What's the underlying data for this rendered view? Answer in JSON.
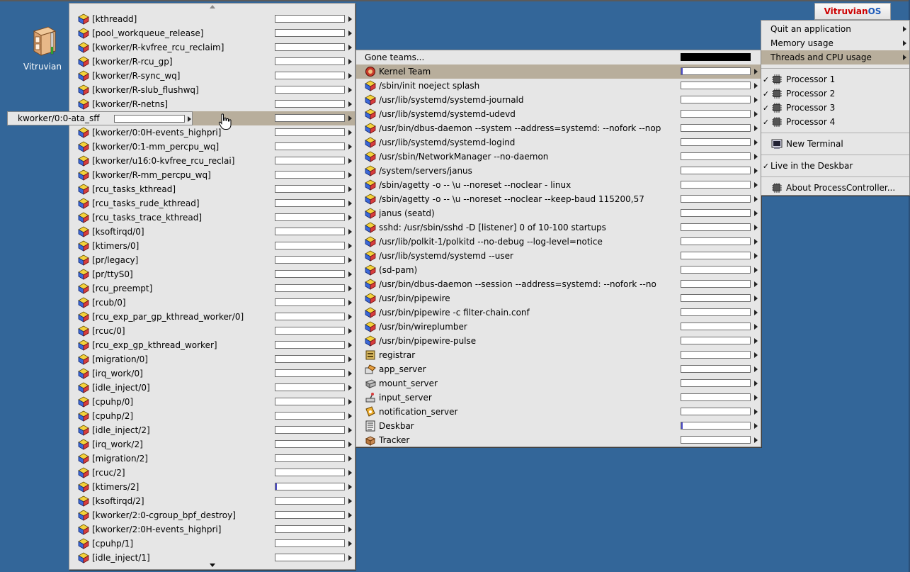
{
  "desktop": {
    "icon_label": "Vitruvian"
  },
  "deskbar": {
    "brand_part1": "Vitruvian",
    "brand_part2": "OS"
  },
  "tooltip": {
    "text": "kworker/0:0-ata_sff"
  },
  "threads": [
    {
      "name": "[kthreadd]",
      "load": 0
    },
    {
      "name": "[pool_workqueue_release]",
      "load": 0
    },
    {
      "name": "[kworker/R-kvfree_rcu_reclaim]",
      "load": 0
    },
    {
      "name": "[kworker/R-rcu_gp]",
      "load": 0
    },
    {
      "name": "[kworker/R-sync_wq]",
      "load": 0
    },
    {
      "name": "[kworker/R-slub_flushwq]",
      "load": 0
    },
    {
      "name": "[kworker/R-netns]",
      "load": 0
    },
    {
      "name": "",
      "load": 0,
      "selected": true
    },
    {
      "name": "[kworker/0:0H-events_highpri]",
      "load": 0
    },
    {
      "name": "[kworker/0:1-mm_percpu_wq]",
      "load": 0
    },
    {
      "name": "[kworker/u16:0-kvfree_rcu_reclai]",
      "load": 0
    },
    {
      "name": "[kworker/R-mm_percpu_wq]",
      "load": 0
    },
    {
      "name": "[rcu_tasks_kthread]",
      "load": 0
    },
    {
      "name": "[rcu_tasks_rude_kthread]",
      "load": 0
    },
    {
      "name": "[rcu_tasks_trace_kthread]",
      "load": 0
    },
    {
      "name": "[ksoftirqd/0]",
      "load": 0
    },
    {
      "name": "[ktimers/0]",
      "load": 0
    },
    {
      "name": "[pr/legacy]",
      "load": 0
    },
    {
      "name": "[pr/ttyS0]",
      "load": 0
    },
    {
      "name": "[rcu_preempt]",
      "load": 0
    },
    {
      "name": "[rcub/0]",
      "load": 0
    },
    {
      "name": "[rcu_exp_par_gp_kthread_worker/0]",
      "load": 0
    },
    {
      "name": "[rcuc/0]",
      "load": 0
    },
    {
      "name": "[rcu_exp_gp_kthread_worker]",
      "load": 0
    },
    {
      "name": "[migration/0]",
      "load": 0
    },
    {
      "name": "[irq_work/0]",
      "load": 0
    },
    {
      "name": "[idle_inject/0]",
      "load": 0
    },
    {
      "name": "[cpuhp/0]",
      "load": 0
    },
    {
      "name": "[cpuhp/2]",
      "load": 0
    },
    {
      "name": "[idle_inject/2]",
      "load": 0
    },
    {
      "name": "[irq_work/2]",
      "load": 0
    },
    {
      "name": "[migration/2]",
      "load": 0
    },
    {
      "name": "[rcuc/2]",
      "load": 0
    },
    {
      "name": "[ktimers/2]",
      "load": 0.01
    },
    {
      "name": "[ksoftirqd/2]",
      "load": 0
    },
    {
      "name": "[kworker/2:0-cgroup_bpf_destroy]",
      "load": 0
    },
    {
      "name": "[kworker/2:0H-events_highpri]",
      "load": 0
    },
    {
      "name": "[cpuhp/1]",
      "load": 0
    },
    {
      "name": "[idle_inject/1]",
      "load": 0
    }
  ],
  "teams": {
    "gone_label": "Gone teams...",
    "items": [
      {
        "name": "Kernel Team",
        "icon": "kernel-icon",
        "load": 0.01,
        "selected": true
      },
      {
        "name": "/sbin/init noeject splash",
        "icon": "app-icon",
        "load": 0
      },
      {
        "name": "/usr/lib/systemd/systemd-journald",
        "icon": "app-icon",
        "load": 0
      },
      {
        "name": "/usr/lib/systemd/systemd-udevd",
        "icon": "app-icon",
        "load": 0
      },
      {
        "name": "/usr/bin/dbus-daemon --system --address=systemd: --nofork --nop",
        "icon": "app-icon",
        "load": 0
      },
      {
        "name": "/usr/lib/systemd/systemd-logind",
        "icon": "app-icon",
        "load": 0
      },
      {
        "name": "/usr/sbin/NetworkManager --no-daemon",
        "icon": "app-icon",
        "load": 0
      },
      {
        "name": "/system/servers/janus",
        "icon": "app-icon",
        "load": 0
      },
      {
        "name": "/sbin/agetty -o -- \\u --noreset --noclear - linux",
        "icon": "app-icon",
        "load": 0
      },
      {
        "name": "/sbin/agetty -o -- \\u --noreset --noclear --keep-baud 115200,57",
        "icon": "app-icon",
        "load": 0
      },
      {
        "name": "janus (seatd)",
        "icon": "app-icon",
        "load": 0
      },
      {
        "name": "sshd: /usr/sbin/sshd -D [listener] 0 of 10-100 startups",
        "icon": "app-icon",
        "load": 0
      },
      {
        "name": "/usr/lib/polkit-1/polkitd --no-debug --log-level=notice",
        "icon": "app-icon",
        "load": 0
      },
      {
        "name": "/usr/lib/systemd/systemd --user",
        "icon": "app-icon",
        "load": 0
      },
      {
        "name": "(sd-pam)",
        "icon": "app-icon",
        "load": 0
      },
      {
        "name": "/usr/bin/dbus-daemon --session --address=systemd: --nofork --no",
        "icon": "app-icon",
        "load": 0
      },
      {
        "name": "/usr/bin/pipewire",
        "icon": "app-icon",
        "load": 0
      },
      {
        "name": "/usr/bin/pipewire -c filter-chain.conf",
        "icon": "app-icon",
        "load": 0
      },
      {
        "name": "/usr/bin/wireplumber",
        "icon": "app-icon",
        "load": 0
      },
      {
        "name": "/usr/bin/pipewire-pulse",
        "icon": "app-icon",
        "load": 0
      },
      {
        "name": "registrar",
        "icon": "registrar-icon",
        "load": 0
      },
      {
        "name": "app_server",
        "icon": "app-server-icon",
        "load": 0
      },
      {
        "name": "mount_server",
        "icon": "mount-server-icon",
        "load": 0
      },
      {
        "name": "input_server",
        "icon": "input-server-icon",
        "load": 0
      },
      {
        "name": "notification_server",
        "icon": "notification-icon",
        "load": 0
      },
      {
        "name": "Deskbar",
        "icon": "deskbar-icon",
        "load": 0.01
      },
      {
        "name": "Tracker",
        "icon": "tracker-icon",
        "load": 0
      }
    ]
  },
  "process_controller": {
    "quit_app": "Quit an application",
    "memory_usage": "Memory usage",
    "threads_cpu": "Threads and CPU usage",
    "processors": [
      "Processor 1",
      "Processor 2",
      "Processor 3",
      "Processor 4"
    ],
    "new_terminal": "New Terminal",
    "live_in_deskbar": "Live in the Deskbar",
    "about": "About ProcessController...",
    "check_mark": "✓"
  }
}
